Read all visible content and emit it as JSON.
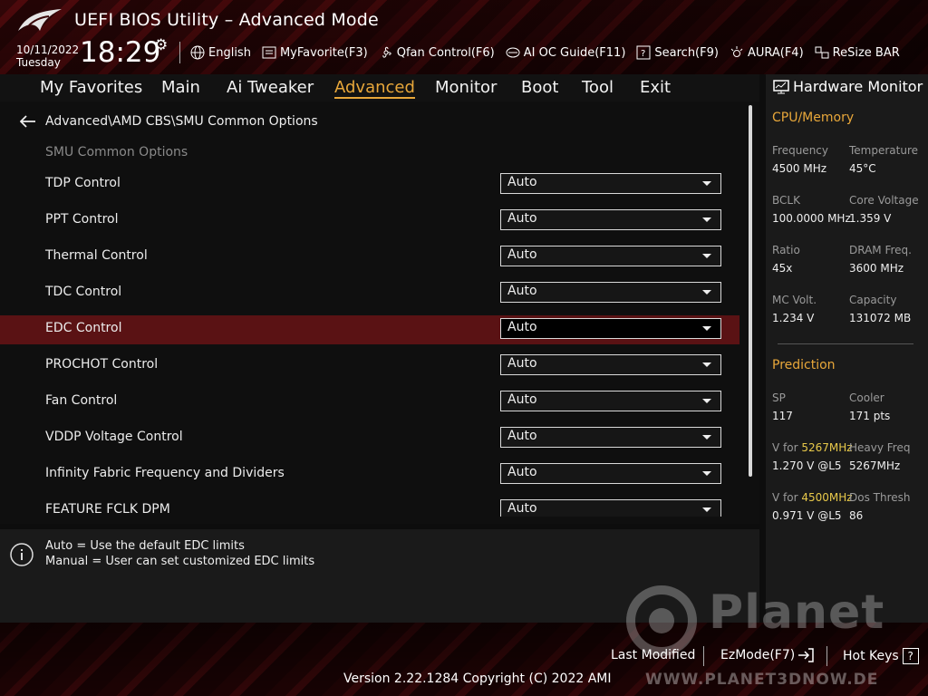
{
  "header": {
    "title": "UEFI BIOS Utility – Advanced Mode",
    "date": "10/11/2022",
    "day": "Tuesday",
    "time": "18:29",
    "tools": [
      {
        "icon": "globe-icon",
        "label": "English"
      },
      {
        "icon": "favorite-icon",
        "label": "MyFavorite(F3)"
      },
      {
        "icon": "fan-icon",
        "label": "Qfan Control(F6)"
      },
      {
        "icon": "oc-guide-icon",
        "label": "AI OC Guide(F11)"
      },
      {
        "icon": "search-icon",
        "label": "Search(F9)"
      },
      {
        "icon": "aura-icon",
        "label": "AURA(F4)"
      },
      {
        "icon": "resize-bar-icon",
        "label": "ReSize BAR"
      }
    ]
  },
  "nav": {
    "tabs": [
      "My Favorites",
      "Main",
      "Ai Tweaker",
      "Advanced",
      "Monitor",
      "Boot",
      "Tool",
      "Exit"
    ],
    "active": "Advanced"
  },
  "main": {
    "breadcrumb": "Advanced\\AMD CBS\\SMU Common Options",
    "section_title": "SMU Common Options",
    "rows": [
      {
        "label": "TDP Control",
        "value": "Auto"
      },
      {
        "label": "PPT Control",
        "value": "Auto"
      },
      {
        "label": "Thermal Control",
        "value": "Auto"
      },
      {
        "label": "TDC Control",
        "value": "Auto"
      },
      {
        "label": "EDC Control",
        "value": "Auto"
      },
      {
        "label": "PROCHOT Control",
        "value": "Auto"
      },
      {
        "label": "Fan Control",
        "value": "Auto"
      },
      {
        "label": "VDDP Voltage Control",
        "value": "Auto"
      },
      {
        "label": "Infinity Fabric Frequency and Dividers",
        "value": "Auto"
      },
      {
        "label": "FEATURE FCLK DPM",
        "value": "Auto"
      }
    ],
    "selected_row": "EDC Control"
  },
  "help": {
    "line1": "Auto = Use the default EDC limits",
    "line2": "Manual = User can set customized EDC limits"
  },
  "hardware_monitor": {
    "title": "Hardware Monitor",
    "cpu_memory": {
      "heading": "CPU/Memory",
      "frequency_label": "Frequency",
      "frequency": "4500 MHz",
      "temperature_label": "Temperature",
      "temperature": "45°C",
      "bclk_label": "BCLK",
      "bclk": "100.0000 MHz",
      "core_voltage_label": "Core Voltage",
      "core_voltage": "1.359 V",
      "ratio_label": "Ratio",
      "ratio": "45x",
      "dram_freq_label": "DRAM Freq.",
      "dram_freq": "3600 MHz",
      "mc_volt_label": "MC Volt.",
      "mc_volt": "1.234 V",
      "capacity_label": "Capacity",
      "capacity": "131072 MB"
    },
    "prediction": {
      "heading": "Prediction",
      "sp_label": "SP",
      "sp": "117",
      "cooler_label": "Cooler",
      "cooler": "171 pts",
      "v_for_label": "V for",
      "v_for_freq1": "5267MHz",
      "v_for_value1": "1.270 V @L5",
      "heavy_freq_label": "Heavy Freq",
      "heavy_freq": "5267MHz",
      "v_for_freq2": "4500MHz",
      "v_for_value2": "0.971 V @L5",
      "dos_thresh_label": "Dos Thresh",
      "dos_thresh": "86"
    }
  },
  "footer": {
    "last_modified": "Last Modified",
    "ezmode": "EzMode(F7)",
    "hot_keys": "Hot Keys",
    "hot_keys_key": "?",
    "version": "Version 2.22.1284 Copyright (C) 2022 AMI"
  },
  "watermark": {
    "brand": "Planet",
    "brand_sub": "3DNow",
    "url": "WWW.PLANET3DNOW.DE"
  },
  "colors": {
    "accent": "#e8a73a",
    "selected_row": "#5a1214",
    "highlight_freq": "#e8c94a"
  }
}
